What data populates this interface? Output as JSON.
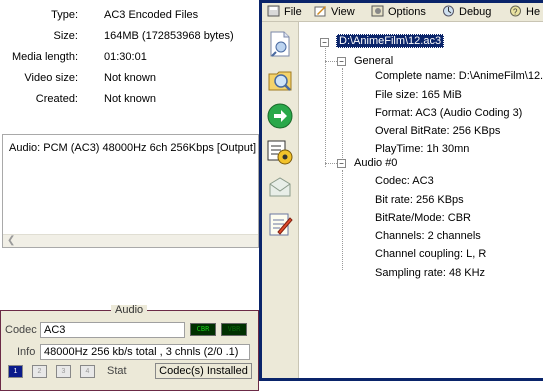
{
  "properties": [
    {
      "label": "Type:",
      "value": "AC3 Encoded Files"
    },
    {
      "label": "Size:",
      "value": "164MB (172853968 bytes)"
    },
    {
      "label": "Media length:",
      "value": "01:30:01"
    },
    {
      "label": "Video size:",
      "value": "Not known"
    },
    {
      "label": "Created:",
      "value": "Not known"
    }
  ],
  "streams": [
    "Audio: PCM (AC3) 48000Hz 6ch 256Kbps [Output]"
  ],
  "audio_box": {
    "legend": "Audio",
    "codec_label": "Codec",
    "codec_value": "AC3",
    "badge_cbr": "CBR",
    "badge_vbr": "VBR",
    "info_label": "Info",
    "info_value": "48000Hz  256 kb/s total , 3 chnls (2/0 .1)",
    "stream_buttons": [
      "1",
      "2",
      "3",
      "4"
    ],
    "stat_label": "Stat",
    "stat_value": "Codec(s) Installed"
  },
  "mediainfo": {
    "menu": [
      "File",
      "View",
      "Options",
      "Debug",
      "He"
    ],
    "root": "D:\\AnimeFilm\\12.ac3",
    "general": {
      "title": "General",
      "items": [
        "Complete name: D:\\AnimeFilm\\12.ac3",
        "File size: 165 MiB",
        "Format: AC3 (Audio Coding 3)",
        "Overal BitRate: 256 KBps",
        "PlayTime: 1h 30mn"
      ]
    },
    "audio": {
      "title": "Audio #0",
      "items": [
        "Codec: AC3",
        "Bit rate: 256 KBps",
        "BitRate/Mode: CBR",
        "Channels: 2 channels",
        "Channel coupling: L, R",
        "Sampling rate: 48 KHz"
      ]
    }
  }
}
